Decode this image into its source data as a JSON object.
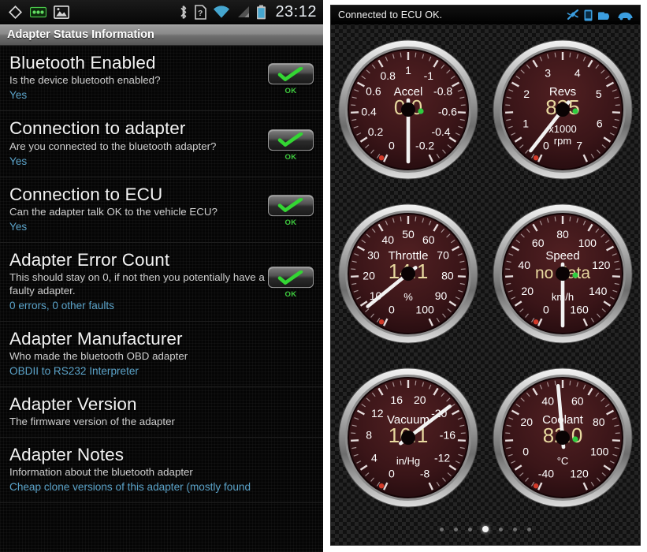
{
  "phone": {
    "statusbar": {
      "left_icons": [
        "rhombus-outline-icon",
        "obd-connector-icon",
        "gallery-image-icon"
      ],
      "right_icons": [
        "bluetooth-icon",
        "sim-unknown-icon",
        "wifi-icon",
        "cell-signal-icon",
        "battery-icon"
      ],
      "clock": "23:12"
    },
    "titlebar": {
      "text": "Adapter Status Information"
    },
    "rows": [
      {
        "title": "Bluetooth Enabled",
        "desc": "Is the device bluetooth enabled?",
        "value": "Yes",
        "badge": "OK",
        "has_badge": true
      },
      {
        "title": "Connection to adapter",
        "desc": "Are you connected to the bluetooth adapter?",
        "value": "Yes",
        "badge": "OK",
        "has_badge": true
      },
      {
        "title": "Connection to ECU",
        "desc": "Can the adapter talk OK to the vehicle ECU?",
        "value": "Yes",
        "badge": "OK",
        "has_badge": true
      },
      {
        "title": "Adapter Error Count",
        "desc": "This should stay on 0, if not then you potentially have a faulty adapter.",
        "value": "0 errors, 0 other faults",
        "badge": "OK",
        "has_badge": true
      },
      {
        "title": "Adapter Manufacturer",
        "desc": "Who made the bluetooth OBD adapter",
        "value": "OBDII to RS232 Interpreter",
        "badge": "",
        "has_badge": false
      },
      {
        "title": "Adapter Version",
        "desc": "The firmware version of the adapter",
        "value": "",
        "badge": "",
        "has_badge": false
      },
      {
        "title": "Adapter Notes",
        "desc": "Information about the bluetooth adapter",
        "value": "Cheap clone versions of this adapter (mostly found",
        "badge": "",
        "has_badge": false
      }
    ]
  },
  "dashboard": {
    "header": {
      "status_text": "Connected to ECU OK.",
      "icons": [
        "connection-icon",
        "phone-icon",
        "adapter-icon",
        "car-icon"
      ],
      "icon_color": "#3b9ee0"
    },
    "colors": {
      "face": "#3a1518",
      "value_text": "#e8d9a0",
      "label_text": "#ffffff",
      "bezel": "#c9c9c9",
      "needle": "#f2f2f2",
      "led": "#2ecc40"
    },
    "gauges": [
      {
        "name": "Accel",
        "value": "0.0",
        "unit": "",
        "sub_unit": "",
        "ticks": [
          "0",
          "0.2",
          "0.4",
          "0.6",
          "0.8",
          "1",
          "-1",
          "-0.8",
          "-0.6",
          "-0.4",
          "-0.2"
        ],
        "min": -1,
        "max": 1,
        "reading": 0.0,
        "needle_angle": 180,
        "led": true
      },
      {
        "name": "Revs",
        "value": "835",
        "unit": "x1000",
        "sub_unit": "rpm",
        "ticks": [
          "0",
          "1",
          "2",
          "3",
          "4",
          "5",
          "6",
          "7"
        ],
        "min": 0,
        "max": 8,
        "reading": 0.835,
        "needle_angle": 218,
        "led": true
      },
      {
        "name": "Throttle",
        "value": "14.1",
        "unit": "%",
        "sub_unit": "",
        "ticks": [
          "0",
          "10",
          "20",
          "30",
          "40",
          "50",
          "60",
          "70",
          "80",
          "90",
          "100"
        ],
        "min": 0,
        "max": 100,
        "reading": 14.1,
        "needle_angle": 231,
        "led": false
      },
      {
        "name": "Speed",
        "value": "no data",
        "unit": "km/h",
        "sub_unit": "",
        "ticks": [
          "0",
          "20",
          "40",
          "60",
          "80",
          "100",
          "120",
          "140",
          "160"
        ],
        "min": 0,
        "max": 180,
        "reading": 0,
        "needle_angle": 180,
        "led": true
      },
      {
        "name": "Vacuum",
        "value": "16.1",
        "unit": "in/Hg",
        "sub_unit": "",
        "ticks": [
          "0",
          "4",
          "8",
          "12",
          "16",
          "20",
          "-20",
          "-16",
          "-12",
          "-8"
        ],
        "min": -20,
        "max": 20,
        "reading": 16.1,
        "needle_angle": 53,
        "led": false
      },
      {
        "name": "Coolant",
        "value": "82.0",
        "unit": "°C",
        "sub_unit": "",
        "ticks": [
          "-40",
          "0",
          "20",
          "40",
          "60",
          "80",
          "100",
          "120"
        ],
        "min": -40,
        "max": 140,
        "reading": 82.0,
        "needle_angle": 355,
        "led": true
      }
    ],
    "pagination": {
      "count": 7,
      "active_index": 3
    }
  }
}
